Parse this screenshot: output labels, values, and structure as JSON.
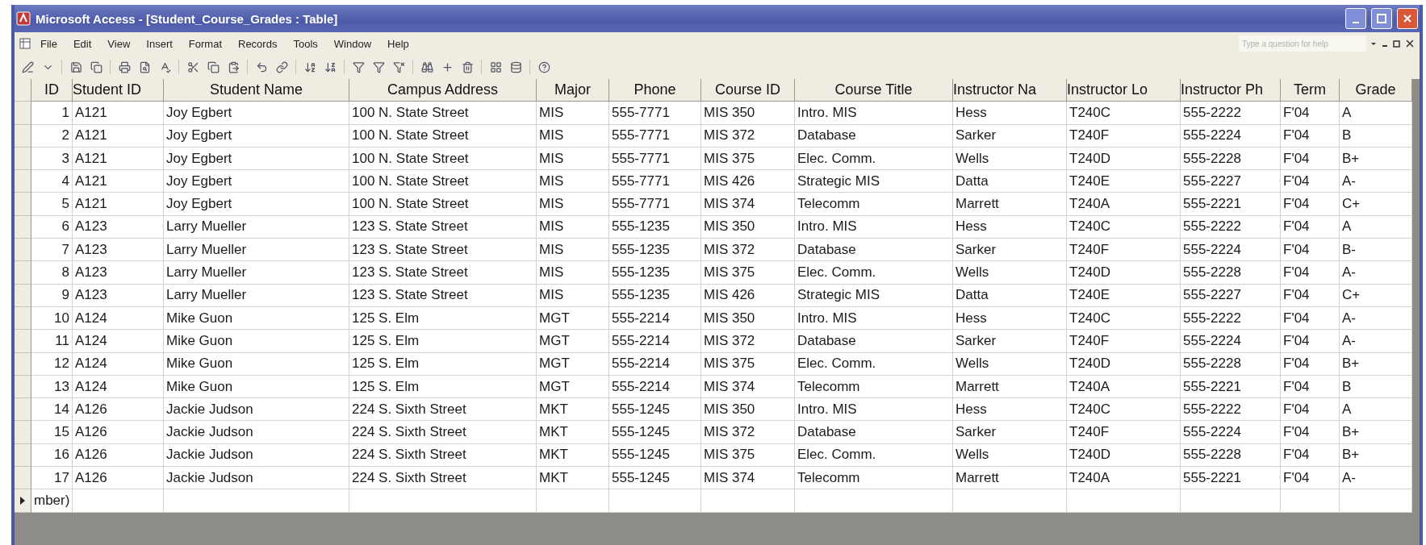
{
  "window": {
    "title": "Microsoft Access - [Student_Course_Grades : Table]"
  },
  "menu": [
    "File",
    "Edit",
    "View",
    "Insert",
    "Format",
    "Records",
    "Tools",
    "Window",
    "Help"
  ],
  "help_search": {
    "placeholder": "Type a question for help"
  },
  "table": {
    "columns": [
      "ID",
      "Student ID",
      "Student Name",
      "Campus Address",
      "Major",
      "Phone",
      "Course ID",
      "Course Title",
      "Instructor Na",
      "Instructor Lo",
      "Instructor Ph",
      "Term",
      "Grade"
    ],
    "rows": [
      [
        "1",
        "A121",
        "Joy Egbert",
        "100 N. State Street",
        "MIS",
        "555-7771",
        "MIS 350",
        "Intro. MIS",
        "Hess",
        "T240C",
        "555-2222",
        "F'04",
        "A"
      ],
      [
        "2",
        "A121",
        "Joy Egbert",
        "100 N. State Street",
        "MIS",
        "555-7771",
        "MIS 372",
        "Database",
        "Sarker",
        "T240F",
        "555-2224",
        "F'04",
        "B"
      ],
      [
        "3",
        "A121",
        "Joy Egbert",
        "100 N. State Street",
        "MIS",
        "555-7771",
        "MIS 375",
        "Elec. Comm.",
        "Wells",
        "T240D",
        "555-2228",
        "F'04",
        "B+"
      ],
      [
        "4",
        "A121",
        "Joy Egbert",
        "100 N. State Street",
        "MIS",
        "555-7771",
        "MIS 426",
        "Strategic MIS",
        "Datta",
        "T240E",
        "555-2227",
        "F'04",
        "A-"
      ],
      [
        "5",
        "A121",
        "Joy Egbert",
        "100 N. State Street",
        "MIS",
        "555-7771",
        "MIS 374",
        "Telecomm",
        "Marrett",
        "T240A",
        "555-2221",
        "F'04",
        "C+"
      ],
      [
        "6",
        "A123",
        "Larry Mueller",
        "123 S. State Street",
        "MIS",
        "555-1235",
        "MIS 350",
        "Intro. MIS",
        "Hess",
        "T240C",
        "555-2222",
        "F'04",
        "A"
      ],
      [
        "7",
        "A123",
        "Larry Mueller",
        "123 S. State Street",
        "MIS",
        "555-1235",
        "MIS 372",
        "Database",
        "Sarker",
        "T240F",
        "555-2224",
        "F'04",
        "B-"
      ],
      [
        "8",
        "A123",
        "Larry Mueller",
        "123 S. State Street",
        "MIS",
        "555-1235",
        "MIS 375",
        "Elec. Comm.",
        "Wells",
        "T240D",
        "555-2228",
        "F'04",
        "A-"
      ],
      [
        "9",
        "A123",
        "Larry Mueller",
        "123 S. State Street",
        "MIS",
        "555-1235",
        "MIS 426",
        "Strategic MIS",
        "Datta",
        "T240E",
        "555-2227",
        "F'04",
        "C+"
      ],
      [
        "10",
        "A124",
        "Mike Guon",
        "125 S. Elm",
        "MGT",
        "555-2214",
        "MIS 350",
        "Intro. MIS",
        "Hess",
        "T240C",
        "555-2222",
        "F'04",
        "A-"
      ],
      [
        "11",
        "A124",
        "Mike Guon",
        "125 S. Elm",
        "MGT",
        "555-2214",
        "MIS 372",
        "Database",
        "Sarker",
        "T240F",
        "555-2224",
        "F'04",
        "A-"
      ],
      [
        "12",
        "A124",
        "Mike Guon",
        "125 S. Elm",
        "MGT",
        "555-2214",
        "MIS 375",
        "Elec. Comm.",
        "Wells",
        "T240D",
        "555-2228",
        "F'04",
        "B+"
      ],
      [
        "13",
        "A124",
        "Mike Guon",
        "125 S. Elm",
        "MGT",
        "555-2214",
        "MIS 374",
        "Telecomm",
        "Marrett",
        "T240A",
        "555-2221",
        "F'04",
        "B"
      ],
      [
        "14",
        "A126",
        "Jackie Judson",
        "224 S. Sixth Street",
        "MKT",
        "555-1245",
        "MIS 350",
        "Intro. MIS",
        "Hess",
        "T240C",
        "555-2222",
        "F'04",
        "A"
      ],
      [
        "15",
        "A126",
        "Jackie Judson",
        "224 S. Sixth Street",
        "MKT",
        "555-1245",
        "MIS 372",
        "Database",
        "Sarker",
        "T240F",
        "555-2224",
        "F'04",
        "B+"
      ],
      [
        "16",
        "A126",
        "Jackie Judson",
        "224 S. Sixth Street",
        "MKT",
        "555-1245",
        "MIS 375",
        "Elec. Comm.",
        "Wells",
        "T240D",
        "555-2228",
        "F'04",
        "B+"
      ],
      [
        "17",
        "A126",
        "Jackie Judson",
        "224 S. Sixth Street",
        "MKT",
        "555-1245",
        "MIS 374",
        "Telecomm",
        "Marrett",
        "T240A",
        "555-2221",
        "F'04",
        "A-"
      ]
    ],
    "new_row": {
      "id": "mber)"
    }
  }
}
